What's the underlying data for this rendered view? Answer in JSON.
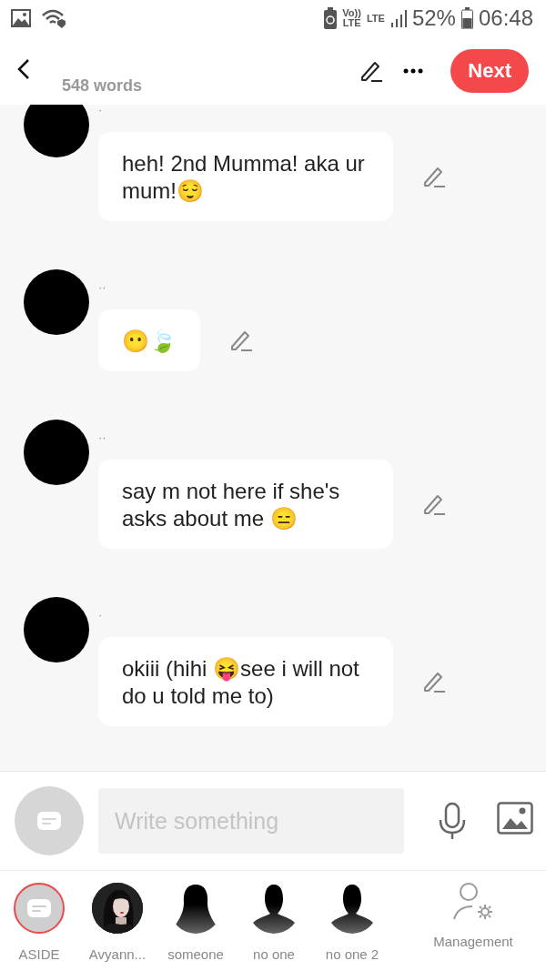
{
  "status_bar": {
    "network_labels": [
      "Vo))",
      "LTE",
      "LTE"
    ],
    "battery": "52%",
    "time": "06:48"
  },
  "header": {
    "word_count": "548 words",
    "next_button": "Next"
  },
  "messages": [
    {
      "sender": "·",
      "text": "heh! 2nd Mumma! aka ur mum!😌"
    },
    {
      "sender": "··",
      "text": "😶🍃"
    },
    {
      "sender": "··",
      "text": "say m not here if she's asks about me 😑"
    },
    {
      "sender": "·",
      "text": "okiii (hihi 😝see i will not do u told me to)"
    }
  ],
  "composer": {
    "placeholder": "Write something"
  },
  "cast": [
    {
      "kind": "aside",
      "label": "ASIDE",
      "selected": true
    },
    {
      "label": "Avyann...",
      "selected": false
    },
    {
      "kind": "silhouette-long",
      "label": "someone",
      "selected": false
    },
    {
      "kind": "silhouette",
      "label": "no one",
      "selected": false
    },
    {
      "kind": "silhouette",
      "label": "no one 2",
      "selected": false
    }
  ],
  "management": {
    "label": "Management"
  }
}
